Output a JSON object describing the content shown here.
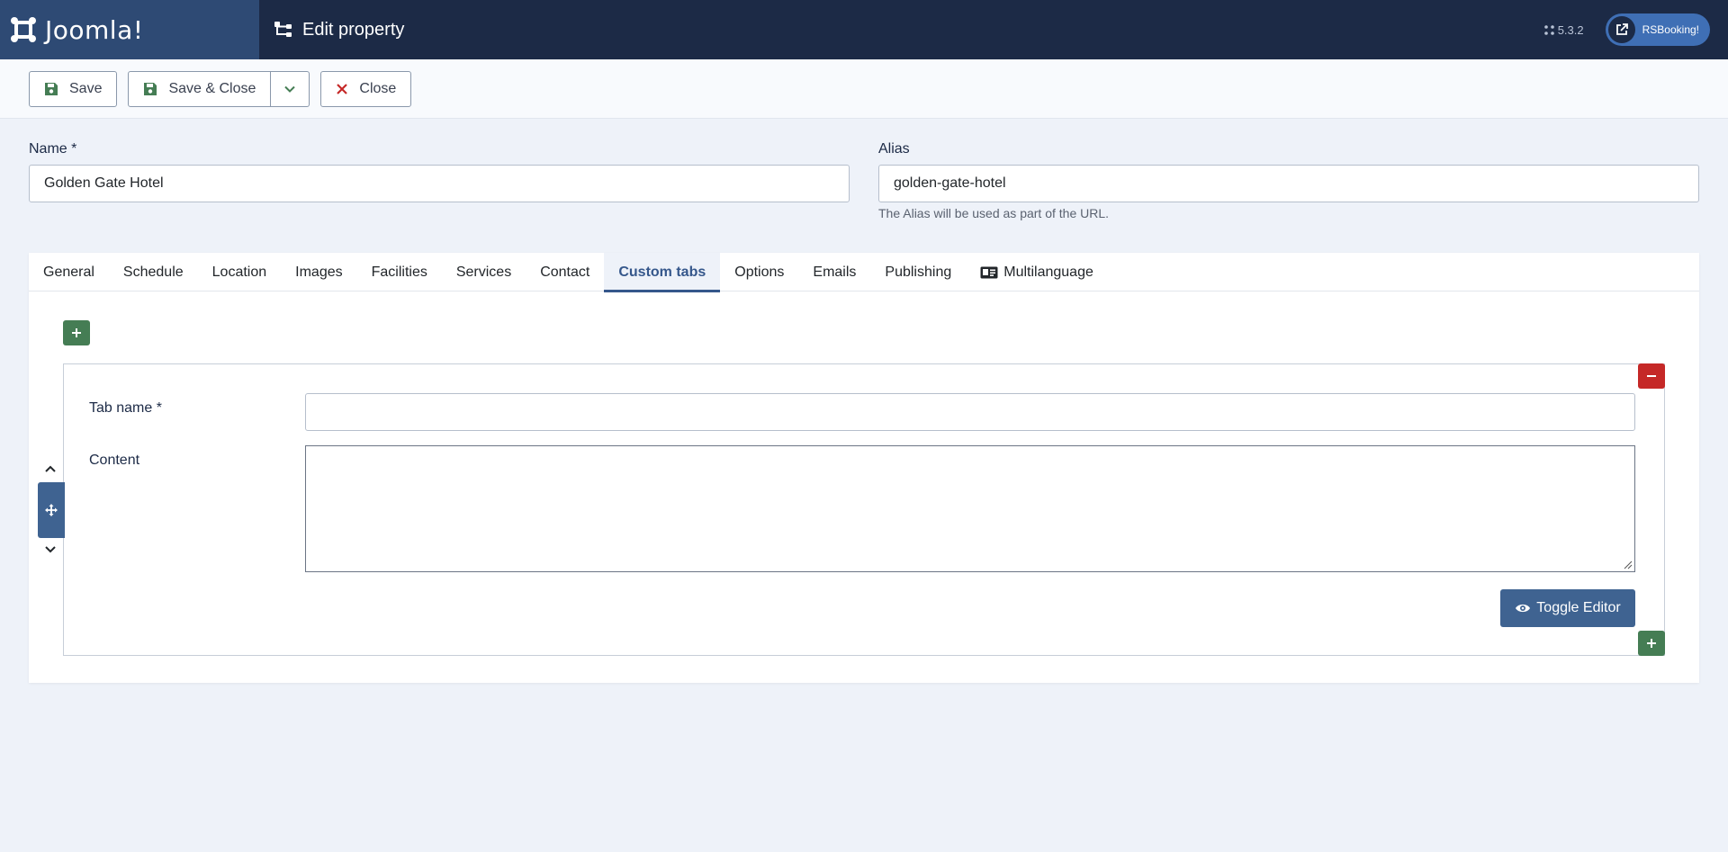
{
  "header": {
    "logo_text": "Joomla!",
    "page_title": "Edit property",
    "version": "5.3.2",
    "site_link": "RSBooking!"
  },
  "toolbar": {
    "save_label": "Save",
    "save_close_label": "Save & Close",
    "close_label": "Close"
  },
  "form": {
    "name_label": "Name *",
    "name_value": "Golden Gate Hotel",
    "alias_label": "Alias",
    "alias_value": "golden-gate-hotel",
    "alias_help": "The Alias will be used as part of the URL."
  },
  "tabs": [
    {
      "label": "General"
    },
    {
      "label": "Schedule"
    },
    {
      "label": "Location"
    },
    {
      "label": "Images"
    },
    {
      "label": "Facilities"
    },
    {
      "label": "Services"
    },
    {
      "label": "Contact"
    },
    {
      "label": "Custom tabs",
      "active": true
    },
    {
      "label": "Options"
    },
    {
      "label": "Emails"
    },
    {
      "label": "Publishing"
    },
    {
      "label": "Multilanguage"
    }
  ],
  "custom_tab_row": {
    "tab_name_label": "Tab name *",
    "tab_name_value": "",
    "content_label": "Content",
    "content_value": "",
    "toggle_editor_label": "Toggle Editor"
  },
  "colors": {
    "header_bg": "#1c2a46",
    "accent": "#35578b",
    "success": "#457d54",
    "danger": "#c52827"
  }
}
